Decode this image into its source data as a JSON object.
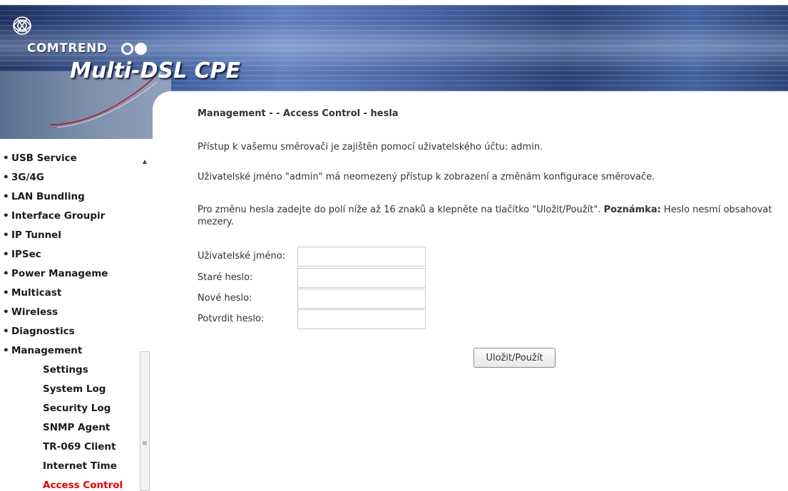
{
  "header": {
    "brand": "COMTREND",
    "product": "Multi-DSL CPE",
    "logo_icon": "comtrend-logo-icon"
  },
  "sidebar": {
    "items": [
      {
        "label": "USB Service",
        "level": 1,
        "active": false
      },
      {
        "label": "3G/4G",
        "level": 1,
        "active": false
      },
      {
        "label": "LAN Bundling",
        "level": 1,
        "active": false
      },
      {
        "label": "Interface Groupir",
        "level": 1,
        "active": false
      },
      {
        "label": "IP Tunnel",
        "level": 1,
        "active": false
      },
      {
        "label": "IPSec",
        "level": 1,
        "active": false
      },
      {
        "label": "Power Manageme",
        "level": 1,
        "active": false
      },
      {
        "label": "Multicast",
        "level": 1,
        "active": false
      },
      {
        "label": "Wireless",
        "level": 1,
        "active": false
      },
      {
        "label": "Diagnostics",
        "level": 1,
        "active": false
      },
      {
        "label": "Management",
        "level": 1,
        "active": false
      },
      {
        "label": "Settings",
        "level": 2,
        "active": false
      },
      {
        "label": "System Log",
        "level": 2,
        "active": false
      },
      {
        "label": "Security Log",
        "level": 2,
        "active": false
      },
      {
        "label": "SNMP Agent",
        "level": 2,
        "active": false
      },
      {
        "label": "TR-069 Client",
        "level": 2,
        "active": false
      },
      {
        "label": "Internet Time",
        "level": 2,
        "active": false
      },
      {
        "label": "Access Control",
        "level": 2,
        "active": true
      }
    ],
    "bullet": "•",
    "active_color": "#e00000"
  },
  "main": {
    "title": "Management - - Access Control - hesla",
    "p1": "Přístup k vašemu směrovači je zajištěn pomocí uživatelského účtu: admin.",
    "p2": "Uživatelské jméno \"admin\" má neomezený přístup k zobrazení a změnám konfigurace směrovače.",
    "p3_a": "Pro změnu hesla zadejte do polí níže až 16 znaků a klepněte na tlačítko \"Uložit/Použít\". ",
    "p3_bold": "Poznámka:",
    "p3_b": " Heslo nesmí obsahovat mezery.",
    "form": {
      "username_label": "Uživatelské jméno:",
      "old_password_label": "Staré heslo:",
      "new_password_label": "Nové heslo:",
      "confirm_password_label": "Potvrdit heslo:",
      "username_value": "",
      "old_password_value": "",
      "new_password_value": "",
      "confirm_password_value": ""
    },
    "save_label": "Uložit/Použít"
  }
}
